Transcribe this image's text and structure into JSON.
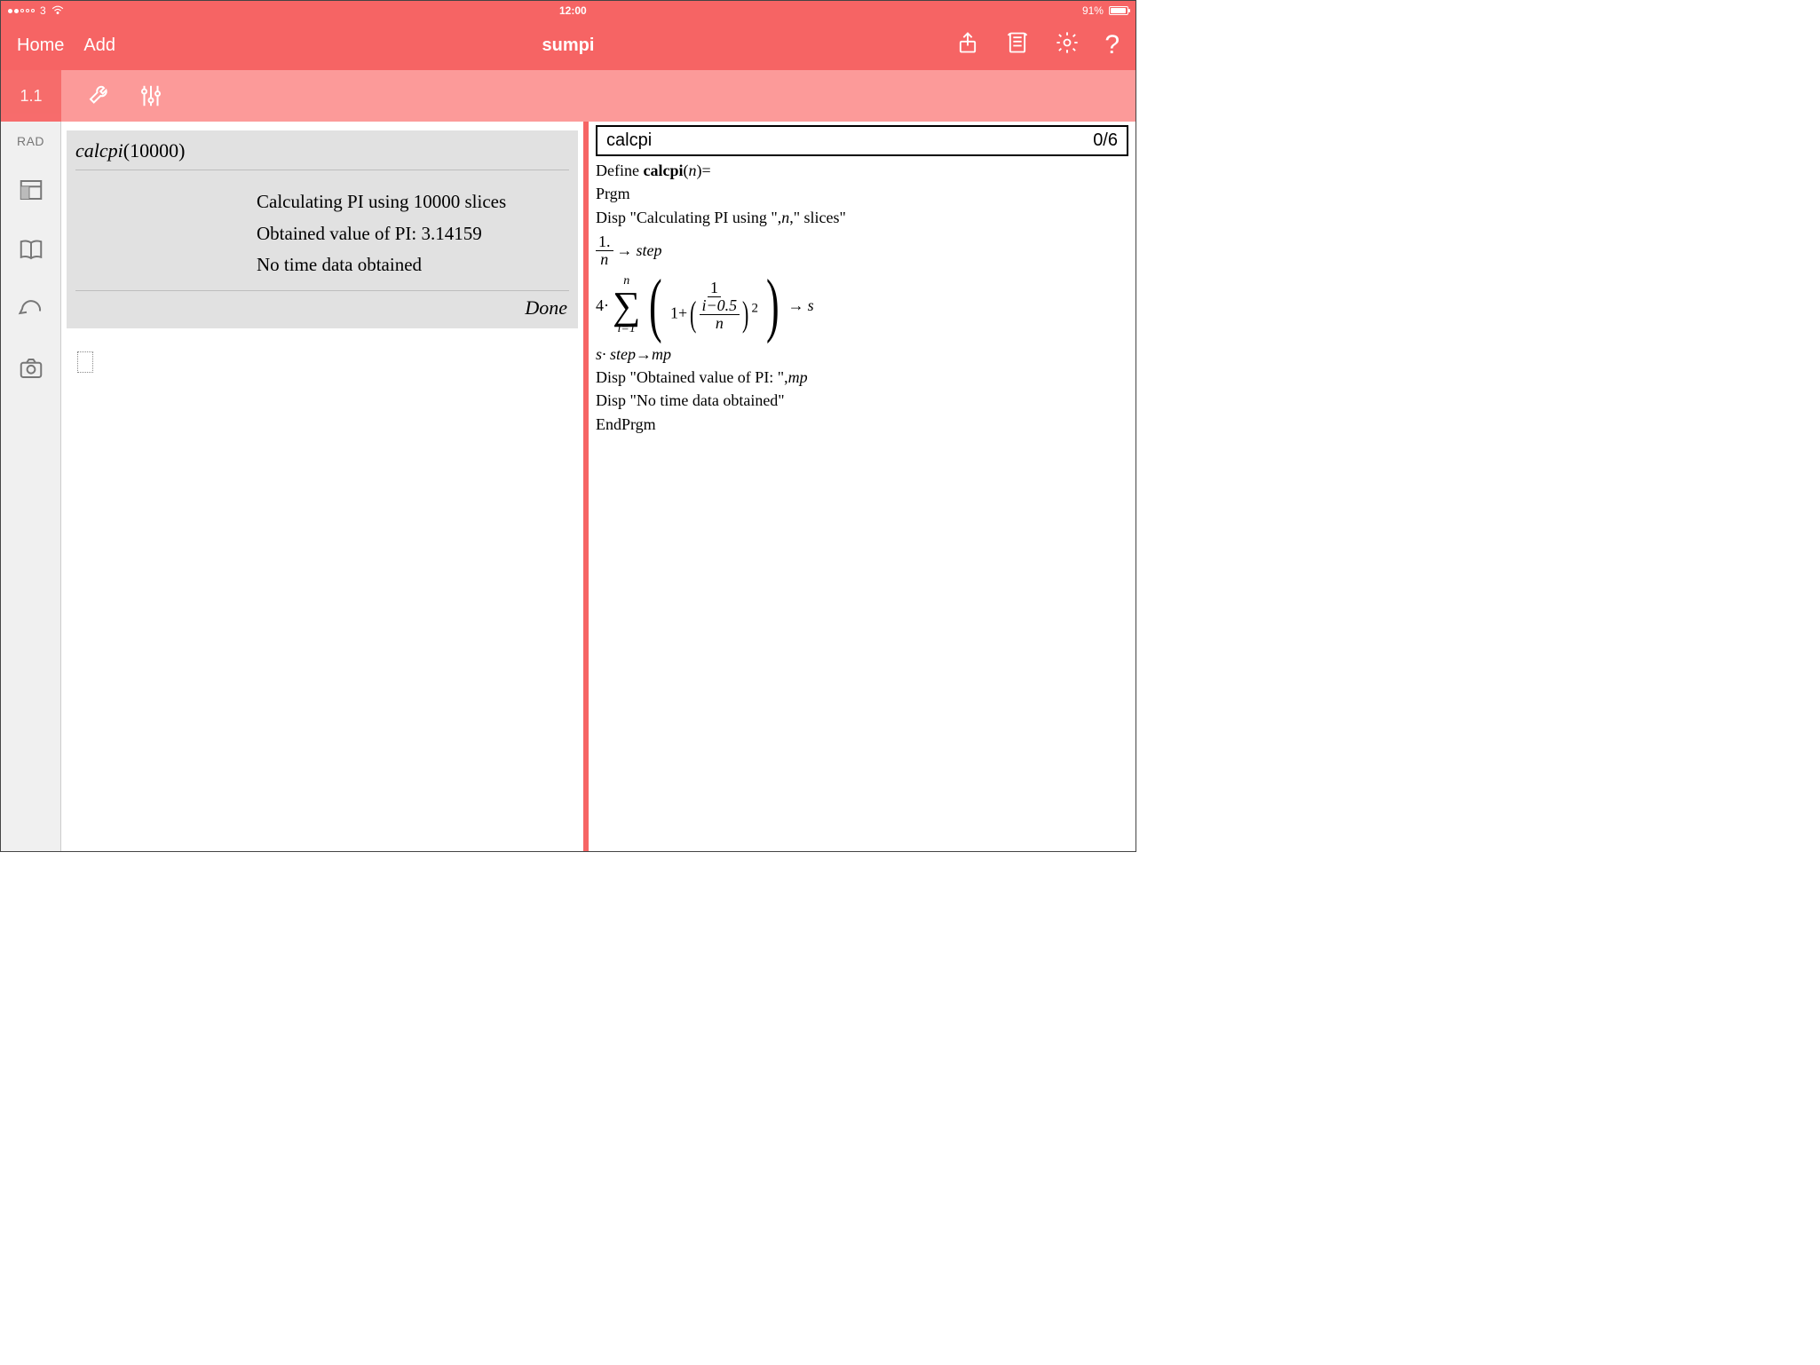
{
  "status": {
    "carrier": "3",
    "time": "12:00",
    "battery_pct": "91%"
  },
  "nav": {
    "home": "Home",
    "add": "Add",
    "title": "sumpi"
  },
  "secbar": {
    "page_tab": "1.1"
  },
  "siderail": {
    "mode": "RAD"
  },
  "left": {
    "call_fn": "calcpi",
    "call_arg": "10000",
    "out_line1": "Calculating PI using  10000  slices",
    "out_line2": "Obtained value of PI:  3.14159",
    "out_line3": "No time data obtained",
    "status": "Done"
  },
  "right": {
    "editor_name": "calcpi",
    "editor_pos": "0/6",
    "define_word": "Define ",
    "define_fn": "calcpi",
    "define_argopen": "(",
    "define_arg": "n",
    "define_argclose": ")=",
    "prgm_open": "Prgm",
    "disp1_pre": "Disp \"Calculating PI using \",",
    "disp1_var": "n",
    "disp1_post": ",\" slices\"",
    "step_num": "1.",
    "step_den": "n",
    "step_arrow": "→",
    "step_var": "step",
    "sum_coef": "4·",
    "sum_upper": "n",
    "sum_lower": "i=1",
    "sum_inner_num": "1",
    "sum_inner_den_lead": "1+",
    "sum_inner_small_num": "i−0.5",
    "sum_inner_small_den": "n",
    "sum_inner_pow": "2",
    "sum_result_arrow": "→",
    "sum_result_var": "s",
    "mp_line": "s· step→mp",
    "disp2": "Disp \"Obtained value of PI: \",",
    "disp2_var": "mp",
    "disp3": "Disp \"No time data obtained\"",
    "endprgm": "EndPrgm"
  }
}
